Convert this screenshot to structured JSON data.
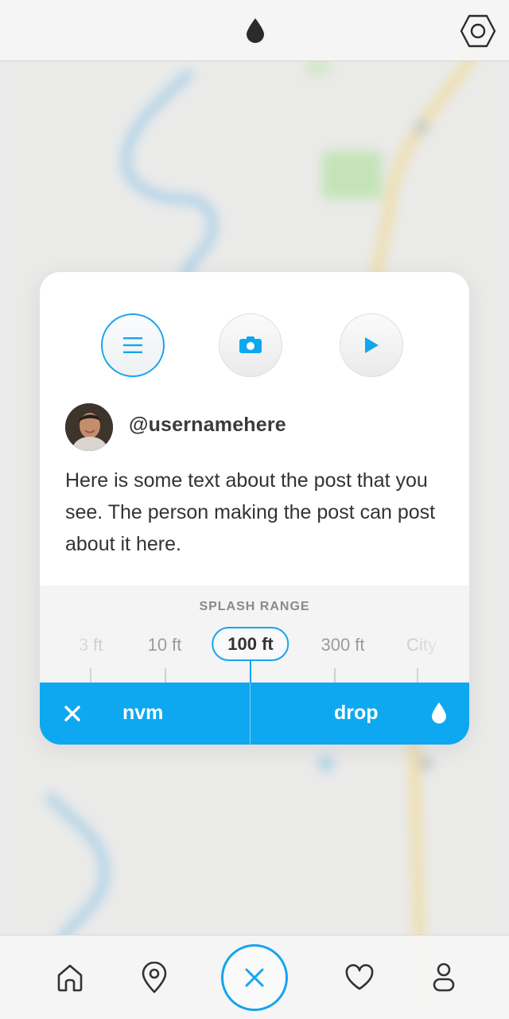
{
  "colors": {
    "accent": "#17a4ef",
    "action_bar": "#0ea8f0",
    "text": "#333333"
  },
  "topbar": {
    "logo_icon": "drop-icon",
    "settings_icon": "hexagon-settings-icon"
  },
  "post_types": [
    {
      "name": "text",
      "icon": "menu-lines-icon",
      "selected": true
    },
    {
      "name": "photo",
      "icon": "camera-icon",
      "selected": false
    },
    {
      "name": "video",
      "icon": "play-icon",
      "selected": false
    }
  ],
  "post": {
    "username": "@usernamehere",
    "text": "Here is some text about the post that you see. The person making the post can post about it here."
  },
  "splash_range": {
    "title": "SPLASH RANGE",
    "options": [
      "3 ft",
      "10 ft",
      "100 ft",
      "300 ft",
      "City"
    ],
    "selected": "100 ft"
  },
  "actions": {
    "cancel_label": "nvm",
    "confirm_label": "drop"
  },
  "bottom_nav": [
    {
      "name": "home",
      "icon": "home-icon"
    },
    {
      "name": "location",
      "icon": "location-pin-icon"
    },
    {
      "name": "close",
      "icon": "close-icon"
    },
    {
      "name": "favorites",
      "icon": "heart-icon"
    },
    {
      "name": "profile",
      "icon": "user-icon"
    }
  ]
}
